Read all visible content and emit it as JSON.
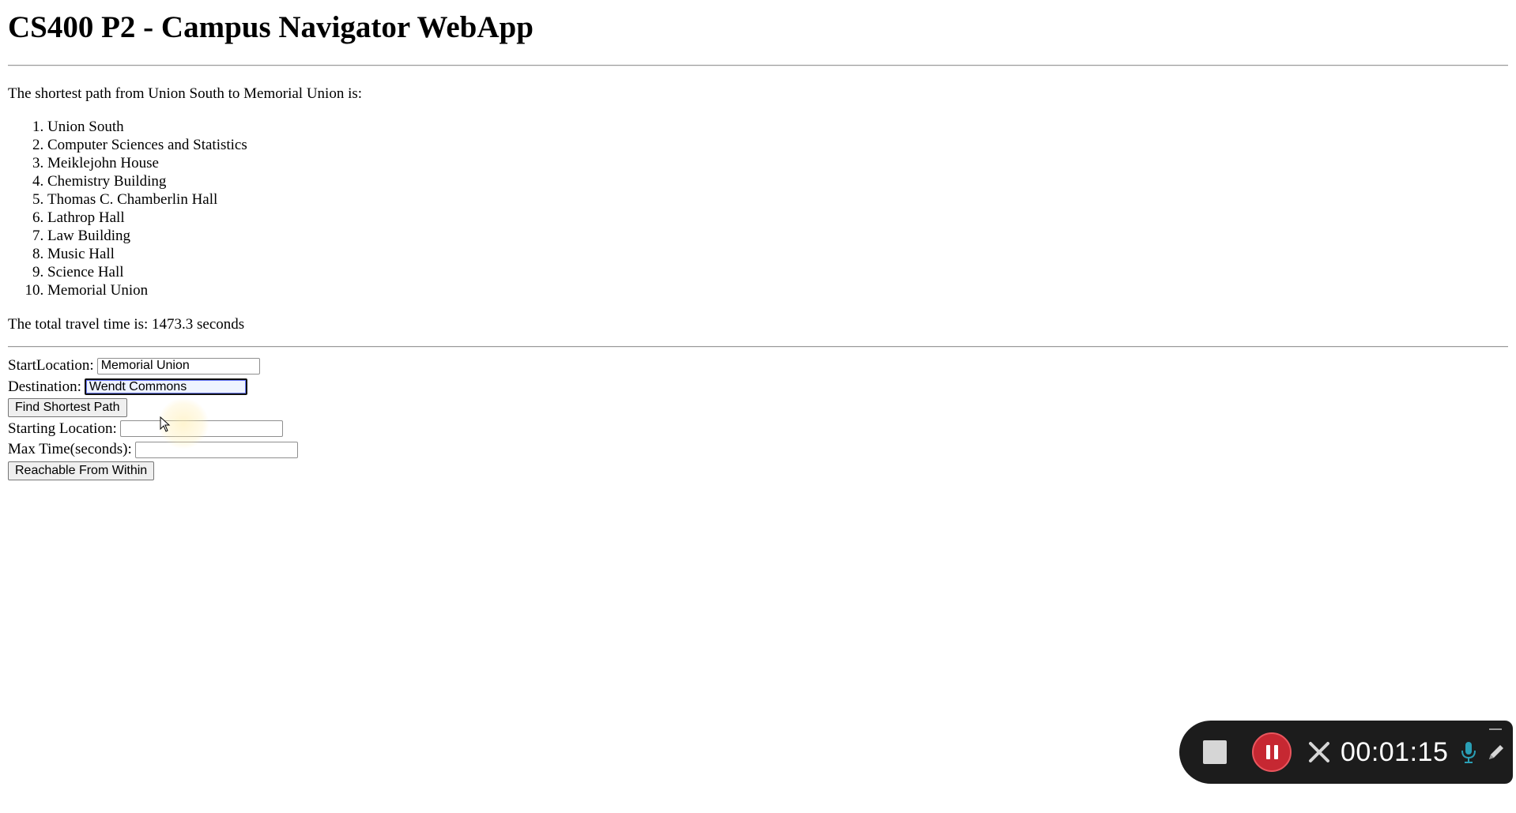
{
  "page": {
    "title": "CS400 P2 - Campus Navigator WebApp",
    "intro_text": "The shortest path from Union South to Memorial Union is:",
    "path": [
      "Union South",
      "Computer Sciences and Statistics",
      "Meiklejohn House",
      "Chemistry Building",
      "Thomas C. Chamberlin Hall",
      "Lathrop Hall",
      "Law Building",
      "Music Hall",
      "Science Hall",
      "Memorial Union"
    ],
    "total_time_text": "The total travel time is: 1473.3 seconds"
  },
  "form": {
    "start_label": "StartLocation:",
    "start_value": "Memorial Union",
    "destination_label": "Destination:",
    "destination_value": "Wendt Commons",
    "find_button": "Find Shortest Path",
    "starting_location_label": "Starting Location:",
    "starting_location_value": "",
    "max_time_label": "Max Time(seconds):",
    "max_time_value": "",
    "reachable_button": "Reachable From Within"
  },
  "recorder": {
    "elapsed": "00:01:15",
    "icons": [
      "stop-icon",
      "pause-icon",
      "close-icon",
      "microphone-icon",
      "pencil-icon",
      "minimize-icon"
    ],
    "colors": {
      "panel": "#1c1c1c",
      "pause": "#c62832",
      "mic": "#2a9fb5"
    }
  }
}
